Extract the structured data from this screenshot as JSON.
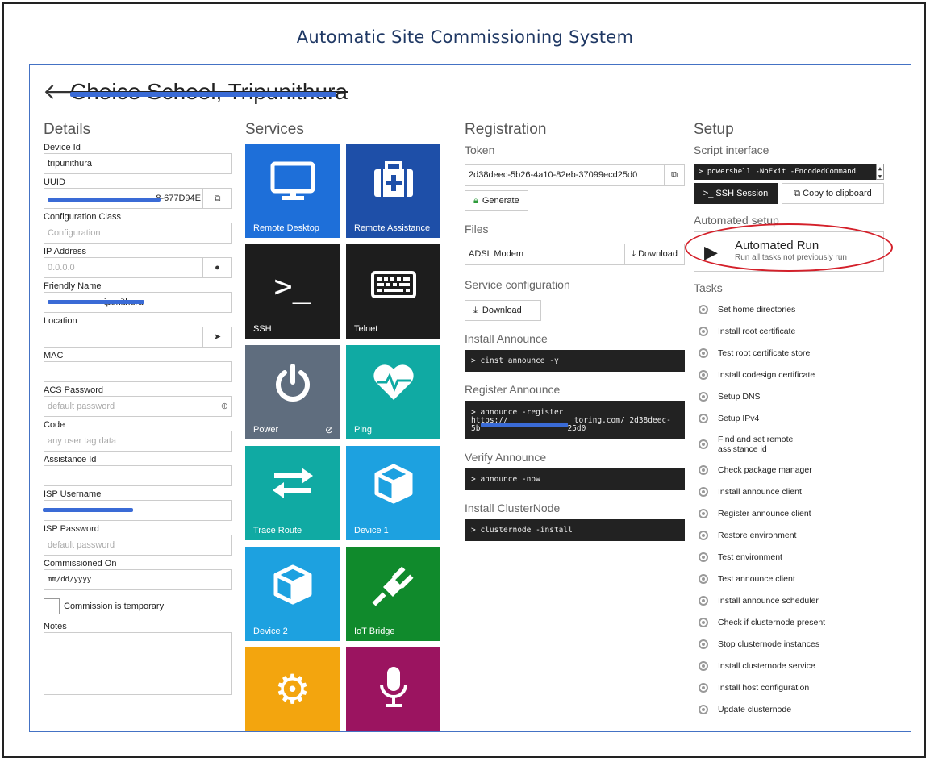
{
  "doc_title": "Automatic Site Commissioning System",
  "site": {
    "title": "Choice School, Tripunithura"
  },
  "details": {
    "heading": "Details",
    "device_id_label": "Device Id",
    "device_id_value": "tripunithura",
    "uuid_label": "UUID",
    "uuid_value": "8-677D94E",
    "config_class_label": "Configuration Class",
    "config_class_placeholder": "Configuration",
    "ip_label": "IP Address",
    "ip_placeholder": "0.0.0.0",
    "friendly_label": "Friendly Name",
    "friendly_value": "ipunithura",
    "location_label": "Location",
    "mac_label": "MAC",
    "acs_password_label": "ACS Password",
    "acs_password_placeholder": "default password",
    "code_label": "Code",
    "code_placeholder": "any user tag data",
    "assistance_label": "Assistance Id",
    "isp_user_label": "ISP Username",
    "isp_password_label": "ISP Password",
    "isp_password_placeholder": "default password",
    "commissioned_label": "Commissioned On",
    "commissioned_placeholder": "mm/dd/yyyy",
    "temporary_label": "Commission is temporary",
    "notes_label": "Notes"
  },
  "services": {
    "heading": "Services",
    "tiles": [
      {
        "label": "Remote Desktop",
        "icon": "monitor-icon",
        "color": "#1e6fd9"
      },
      {
        "label": "Remote Assistance",
        "icon": "medical-kit-icon",
        "color": "#1e4fa8"
      },
      {
        "label": "SSH",
        "icon": "terminal-icon",
        "color": "#1d1d1d"
      },
      {
        "label": "Telnet",
        "icon": "keyboard-icon",
        "color": "#1d1d1d"
      },
      {
        "label": "Power",
        "icon": "power-icon",
        "color": "#5f6d7e"
      },
      {
        "label": "Ping",
        "icon": "heartbeat-icon",
        "color": "#10aaa3"
      },
      {
        "label": "Trace Route",
        "icon": "exchange-icon",
        "color": "#10aaa3"
      },
      {
        "label": "Device 1",
        "icon": "cube-icon",
        "color": "#1da1e0"
      },
      {
        "label": "Device 2",
        "icon": "cube-icon",
        "color": "#1da1e0"
      },
      {
        "label": "IoT Bridge",
        "icon": "plug-icon",
        "color": "#108a2c"
      },
      {
        "label": "",
        "icon": "gear-icon",
        "color": "#f3a50e"
      },
      {
        "label": "",
        "icon": "microphone-icon",
        "color": "#9b1460"
      }
    ]
  },
  "registration": {
    "heading": "Registration",
    "token_label": "Token",
    "token_value": "2d38deec-5b26-4a10-82eb-37099ecd25d0",
    "generate_label": "Generate",
    "files_label": "Files",
    "file_name": "ADSL Modem",
    "file_download_label": "Download",
    "service_config_label": "Service configuration",
    "service_download_label": "Download",
    "install_announce_label": "Install Announce",
    "install_announce_cmd": "> cinst announce -y",
    "register_announce_label": "Register Announce",
    "register_announce_line1": "> announce -register",
    "register_announce_line2": "https://",
    "register_announce_line2b": "toring.com/ 2d38deec-",
    "register_announce_line3": "5b",
    "register_announce_line3b": "25d0",
    "verify_announce_label": "Verify Announce",
    "verify_announce_cmd": "> announce -now",
    "install_cluster_label": "Install ClusterNode",
    "install_cluster_cmd": "> clusternode -install"
  },
  "setup": {
    "heading": "Setup",
    "script_label": "Script interface",
    "script_cmd": "> powershell -NoExit -EncodedCommand",
    "ssh_session_label": ">_ SSH Session",
    "copy_clipboard_label": "Copy to clipboard",
    "automated_setup_label": "Automated setup",
    "automated_run_title": "Automated Run",
    "automated_run_sub": "Run all tasks not previously run",
    "tasks_label": "Tasks",
    "tasks": [
      "Set home directories",
      "Install root certificate",
      "Test root certificate store",
      "Install codesign certificate",
      "Setup DNS",
      "Setup IPv4",
      "Find and set remote assistance id",
      "Check package manager",
      "Install announce client",
      "Register announce client",
      "Restore environment",
      "Test environment",
      "Test announce client",
      "Install announce scheduler",
      "Check if clusternode present",
      "Stop clusternode instances",
      "Install clusternode service",
      "Install host configuration",
      "Update clusternode"
    ]
  }
}
